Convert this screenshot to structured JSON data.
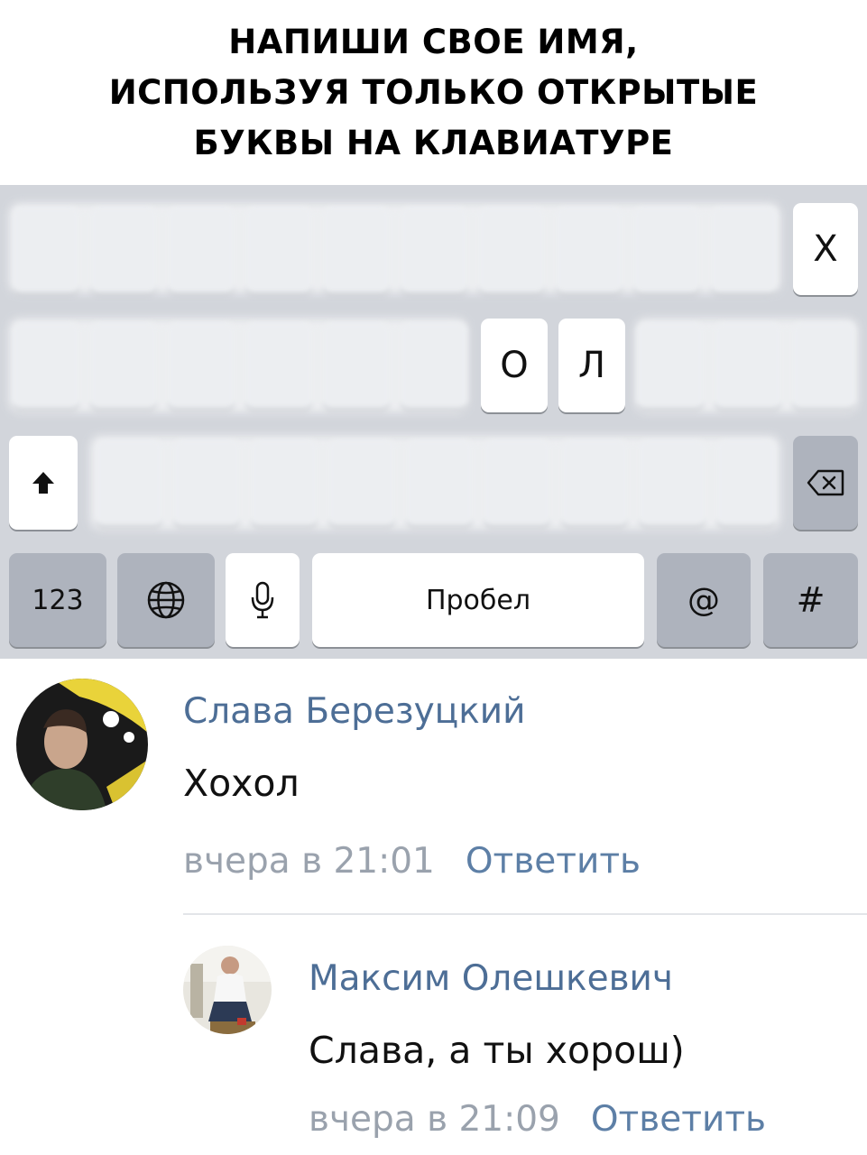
{
  "caption": {
    "line1": "НАПИШИ СВОЕ ИМЯ,",
    "line2": "ИСПОЛЬЗУЯ ТОЛЬКО ОТКРЫТЫЕ",
    "line3": "БУКВЫ НА КЛАВИАТУРЕ"
  },
  "keyboard": {
    "visible_keys": [
      "Х",
      "О",
      "Л"
    ],
    "shift_icon": "shift-icon",
    "backspace_icon": "backspace-icon",
    "bottom_row": {
      "numbers_label": "123",
      "globe_icon": "globe-icon",
      "mic_icon": "microphone-icon",
      "space_label": "Пробел",
      "at_label": "@",
      "hash_label": "#"
    }
  },
  "comments": [
    {
      "author": "Слава Березуцкий",
      "text": "Хохол",
      "time": "вчера в 21:01",
      "reply_label": "Ответить"
    },
    {
      "author": "Максим Олешкевич",
      "text": "Слава, а ты хорош)",
      "time": "вчера в 21:09",
      "reply_label": "Ответить"
    }
  ],
  "colors": {
    "keyboard_bg": "#d2d5db",
    "author_name": "#4d6e96",
    "reply_link": "#5d7fa6",
    "timestamp": "#9aa2ad"
  }
}
